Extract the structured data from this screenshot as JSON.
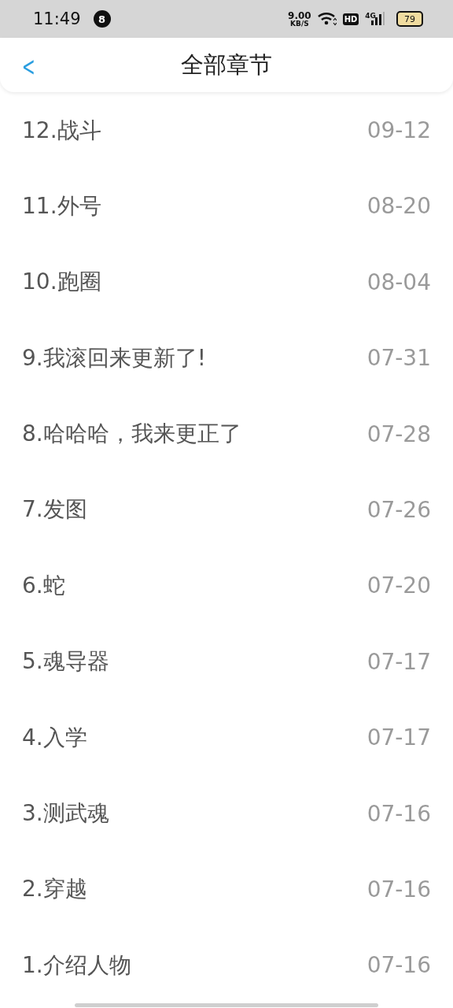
{
  "status_bar": {
    "time": "11:49",
    "notification_count": "8",
    "speed_value": "9.00",
    "speed_unit": "KB/S",
    "hd": "HD",
    "network": "4G",
    "battery": "79"
  },
  "header": {
    "back": "<",
    "title": "全部章节"
  },
  "chapters": [
    {
      "title": "12.战斗",
      "date": "09-12"
    },
    {
      "title": "11.外号",
      "date": "08-20"
    },
    {
      "title": "10.跑圈",
      "date": "08-04"
    },
    {
      "title": "9.我滚回来更新了!",
      "date": "07-31"
    },
    {
      "title": "8.哈哈哈，我来更正了",
      "date": "07-28"
    },
    {
      "title": "7.发图",
      "date": "07-26"
    },
    {
      "title": "6.蛇",
      "date": "07-20"
    },
    {
      "title": "5.魂导器",
      "date": "07-17"
    },
    {
      "title": "4.入学",
      "date": "07-17"
    },
    {
      "title": "3.测武魂",
      "date": "07-16"
    },
    {
      "title": "2.穿越",
      "date": "07-16"
    },
    {
      "title": "1.介绍人物",
      "date": "07-16"
    }
  ]
}
